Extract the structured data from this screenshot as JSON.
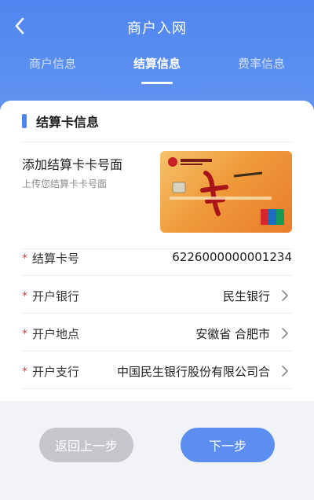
{
  "nav": {
    "title": "商户入网"
  },
  "tabs": [
    {
      "label": "商户信息"
    },
    {
      "label": "结算信息"
    },
    {
      "label": "费率信息"
    }
  ],
  "section": {
    "title": "结算卡信息"
  },
  "upload": {
    "title": "添加结算卡卡号面",
    "subtitle": "上传您结算卡卡号面"
  },
  "fields": [
    {
      "label": "结算卡号",
      "value": "6226000000001234"
    },
    {
      "label": "开户银行",
      "value": "民生银行"
    },
    {
      "label": "开户地点",
      "value": "安徽省 合肥市"
    },
    {
      "label": "开户支行",
      "value": "中国民生银行股份有限公司合"
    }
  ],
  "required_mark": "*",
  "buttons": {
    "back": "返回上一步",
    "next": "下一步"
  },
  "colors": {
    "primary": "#4f86ef",
    "required": "#e0353b",
    "disabled": "#c4c6cc"
  }
}
